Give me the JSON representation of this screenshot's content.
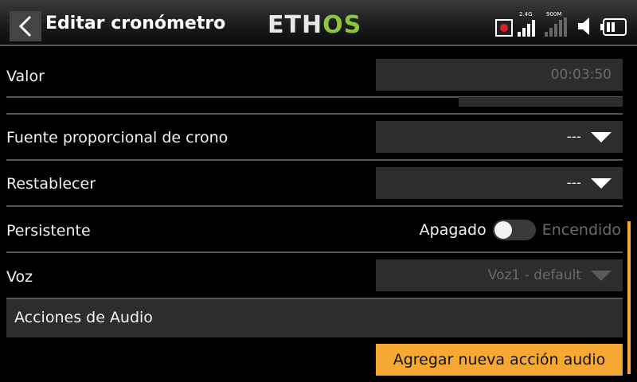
{
  "header": {
    "title": "Editar cronómetro",
    "logo_part1": "ETH",
    "logo_part2": "OS",
    "rf_label_1": "2.4G",
    "rf_label_2": "900M"
  },
  "rows": {
    "value_label": "Valor",
    "value_field": "00:03:50",
    "proportional_label": "Fuente proporcional de crono",
    "proportional_value": "---",
    "reset_label": "Restablecer",
    "reset_value": "---",
    "persistent_label": "Persistente",
    "persistent_off": "Apagado",
    "persistent_on": "Encendido",
    "persistent_state": "off",
    "voice_label": "Voz",
    "voice_value": "Voz1 - default"
  },
  "audio": {
    "section_label": "Acciones de Audio",
    "add_button": "Agregar nueva acción audio"
  },
  "colors": {
    "accent": "#f5a933",
    "logo_green": "#8cc63f",
    "record": "#e02020"
  },
  "icons": [
    "back-arrow-icon",
    "record-icon",
    "signal-icon",
    "speaker-icon",
    "battery-icon",
    "dropdown-arrow-icon"
  ]
}
